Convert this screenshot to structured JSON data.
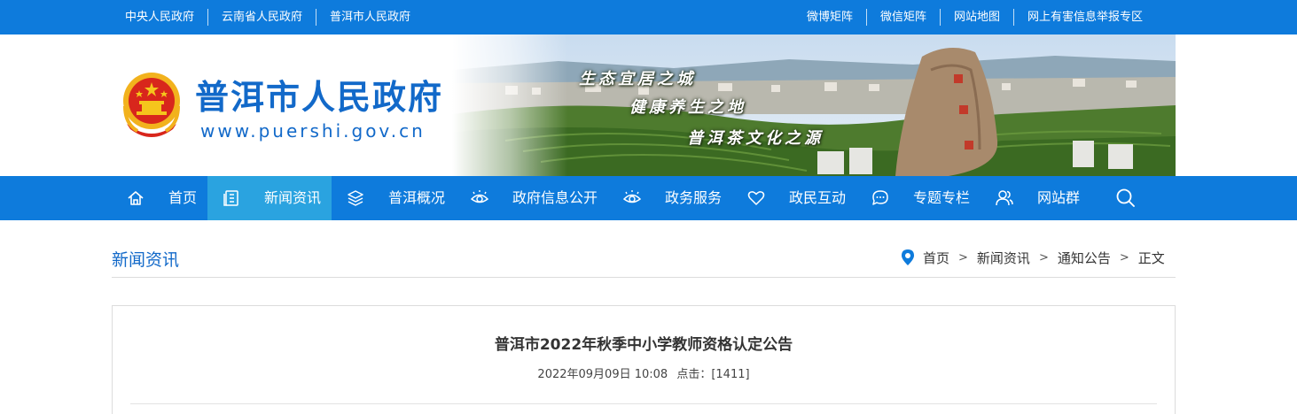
{
  "topbar": {
    "left_links": [
      "中央人民政府",
      "云南省人民政府",
      "普洱市人民政府"
    ],
    "right_links": [
      "微博矩阵",
      "微信矩阵",
      "网站地图",
      "网上有害信息举报专区"
    ]
  },
  "header": {
    "site_name": "普洱市人民政府",
    "site_url": "www.puershi.gov.cn",
    "logo_icon": "national-emblem",
    "slogans": [
      "生态宜居之城",
      "健康养生之地",
      "普洱茶文化之源"
    ]
  },
  "nav": {
    "items": [
      {
        "label": "首页",
        "icon": "home-icon",
        "active": false
      },
      {
        "label": "新闻资讯",
        "icon": "news-icon",
        "active": true
      },
      {
        "label": "普洱概况",
        "icon": "layers-icon",
        "active": false
      },
      {
        "label": "政府信息公开",
        "icon": "eye-icon",
        "active": false
      },
      {
        "label": "政务服务",
        "icon": "eye-icon",
        "active": false
      },
      {
        "label": "政民互动",
        "icon": "heart-icon",
        "active": false
      },
      {
        "label": "专题专栏",
        "icon": "chat-icon",
        "active": false
      },
      {
        "label": "网站群",
        "icon": "users-icon",
        "active": false
      }
    ],
    "search_icon": "search-icon"
  },
  "breadcrumb": {
    "section_title": "新闻资讯",
    "items": [
      "首页",
      "新闻资讯",
      "通知公告",
      "正文"
    ],
    "separator": ">"
  },
  "article": {
    "title": "普洱市2022年秋季中小学教师资格认定公告",
    "date": "2022年09月09日 10:08",
    "clicks_label": "点击：[1411]"
  },
  "colors": {
    "brand_blue": "#0e7bdc",
    "nav_active": "#2aa3e0",
    "title_blue": "#1269c9"
  }
}
